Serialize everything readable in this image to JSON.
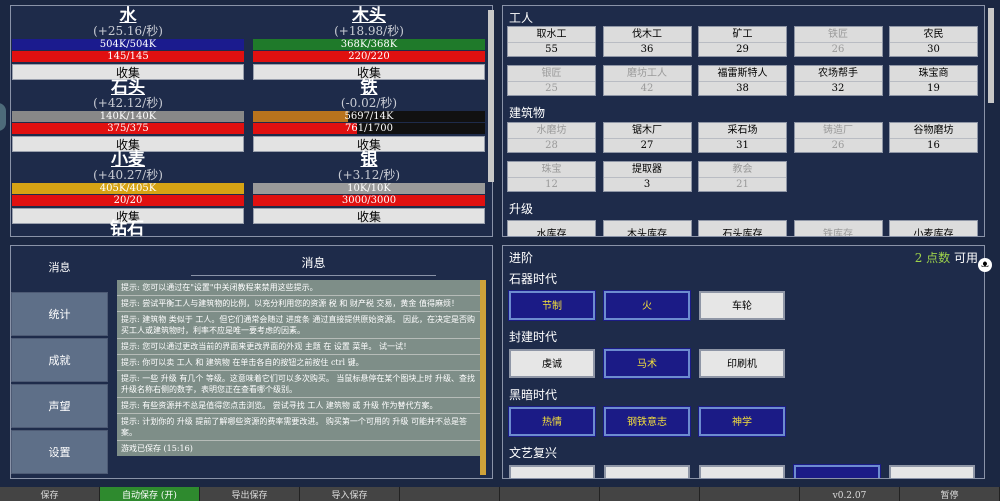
{
  "resources": [
    {
      "name": "水",
      "rate": "(+25.16/秒)",
      "capacity": "504K/504K",
      "capacity_fill": 1.0,
      "bar_color": "#1b1b8e",
      "workers": "145/145",
      "workers_fill": 1.0,
      "button": "收集"
    },
    {
      "name": "木头",
      "rate": "(+18.98/秒)",
      "capacity": "368K/368K",
      "capacity_fill": 1.0,
      "bar_color": "#1f7a2a",
      "workers": "220/220",
      "workers_fill": 1.0,
      "button": "收集"
    },
    {
      "name": "石头",
      "rate": "(+42.12/秒)",
      "capacity": "140K/140K",
      "capacity_fill": 1.0,
      "bar_color": "#888888",
      "workers": "375/375",
      "workers_fill": 1.0,
      "button": "收集"
    },
    {
      "name": "铁",
      "rate": "(-0.02/秒)",
      "capacity": "5697/14K",
      "capacity_fill": 0.41,
      "bar_color": "#b8731d",
      "workers": "761/1700",
      "workers_fill": 0.45,
      "button": "收集"
    },
    {
      "name": "小麦",
      "rate": "(+40.27/秒)",
      "capacity": "405K/405K",
      "capacity_fill": 1.0,
      "bar_color": "#d6a314",
      "workers": "20/20",
      "workers_fill": 1.0,
      "button": "收集"
    },
    {
      "name": "银",
      "rate": "(+3.12/秒)",
      "capacity": "10K/10K",
      "capacity_fill": 1.0,
      "bar_color": "#9a9a9a",
      "workers": "3000/3000",
      "workers_fill": 1.0,
      "button": "收集"
    }
  ],
  "partial_resource": "钻石",
  "workers_title": "工人",
  "workers": [
    {
      "label": "取水工",
      "value": "55",
      "enabled": true
    },
    {
      "label": "伐木工",
      "value": "36",
      "enabled": true
    },
    {
      "label": "矿工",
      "value": "29",
      "enabled": true
    },
    {
      "label": "铁匠",
      "value": "26",
      "enabled": false
    },
    {
      "label": "农民",
      "value": "30",
      "enabled": true
    },
    {
      "label": "银匠",
      "value": "25",
      "enabled": false
    },
    {
      "label": "磨坊工人",
      "value": "42",
      "enabled": false
    },
    {
      "label": "福雷斯特人",
      "value": "38",
      "enabled": true
    },
    {
      "label": "农场帮手",
      "value": "32",
      "enabled": true
    },
    {
      "label": "珠宝商",
      "value": "19",
      "enabled": true
    }
  ],
  "buildings_title": "建筑物",
  "buildings": [
    {
      "label": "水磨坊",
      "value": "28",
      "enabled": false
    },
    {
      "label": "锯木厂",
      "value": "27",
      "enabled": true
    },
    {
      "label": "采石场",
      "value": "31",
      "enabled": true
    },
    {
      "label": "铸造厂",
      "value": "26",
      "enabled": false
    },
    {
      "label": "谷物磨坊",
      "value": "16",
      "enabled": true
    },
    {
      "label": "珠宝",
      "value": "12",
      "enabled": false
    },
    {
      "label": "提取器",
      "value": "3",
      "enabled": true
    },
    {
      "label": "教会",
      "value": "21",
      "enabled": false
    }
  ],
  "upgrades_title": "升级",
  "upgrades": [
    "水库存",
    "木头库存",
    "石头库存",
    "铁库存",
    "小麦库存"
  ],
  "messages_panel": {
    "tabs": [
      "消息",
      "统计",
      "成就",
      "声望",
      "设置"
    ],
    "heading": "消息",
    "lines": [
      "提示: 您可以通过在\"设置\"中关闭教程来禁用这些提示。",
      "提示: 尝试平衡工人与建筑物的比例，以充分利用您的资源 税 和 财产税 交易，黄金 值得麻烦！",
      "提示: 建筑物 类似于 工人。但它们通常会随过 进度条 通过直接提供原始资源。 因此，在决定是否购买工人或建筑物时，利率不应是唯一要考虑的因素。",
      "提示: 您可以通过更改当前的界面来更改界面的外观 主题 在 设置 菜单。 试一试！",
      "提示: 你可以卖 工人 和 建筑物 在单击各自的按钮之前按住 ctrl 键。",
      "提示: 一些 升级 有几个 等级。这意味着它们可以多次购买。 当鼠标悬停在某个图块上时 升级、查找升级名称右侧的数字，表明您正在查看哪个级别。",
      "提示: 有些资源并不总是值得您点击浏览。 尝试寻找 工人 建筑物 或 升级 作为替代方案。",
      "提示: 计划你的 升级 提前了解哪些资源的费率需要改进。 购买第一个可用的 升级 可能并不总是答案。",
      "游戏已保存 (15:16)"
    ]
  },
  "progress_panel": {
    "title": "进阶",
    "points_count": "2 点数",
    "points_suffix": "可用",
    "eras": [
      {
        "name": "石器时代",
        "items": [
          {
            "label": "节制",
            "style": "blue"
          },
          {
            "label": "火",
            "style": "blue"
          },
          {
            "label": "车轮",
            "style": "white"
          }
        ]
      },
      {
        "name": "封建时代",
        "items": [
          {
            "label": "虔诚",
            "style": "white"
          },
          {
            "label": "马术",
            "style": "blue"
          },
          {
            "label": "印刷机",
            "style": "white"
          }
        ]
      },
      {
        "name": "黑暗时代",
        "items": [
          {
            "label": "热情",
            "style": "blue"
          },
          {
            "label": "钢铁意志",
            "style": "blue"
          },
          {
            "label": "神学",
            "style": "blue"
          }
        ]
      },
      {
        "name": "文艺复兴",
        "items": [
          {
            "label": "",
            "style": "white"
          },
          {
            "label": "",
            "style": "white"
          },
          {
            "label": "",
            "style": "white"
          },
          {
            "label": "",
            "style": "blue"
          },
          {
            "label": "",
            "style": "white"
          }
        ]
      }
    ]
  },
  "bottom_bar": [
    "保存",
    "自动保存 (开)",
    "导出保存",
    "导入保存",
    "",
    "",
    "",
    "",
    "v0.2.07",
    "暂停"
  ],
  "colors": {
    "panel_bg": "#1e2b4a",
    "page_bg": "#1b2742",
    "workers_bar": "#e01010",
    "points": "#9dd14a",
    "era_blue": "#1b1b86"
  }
}
